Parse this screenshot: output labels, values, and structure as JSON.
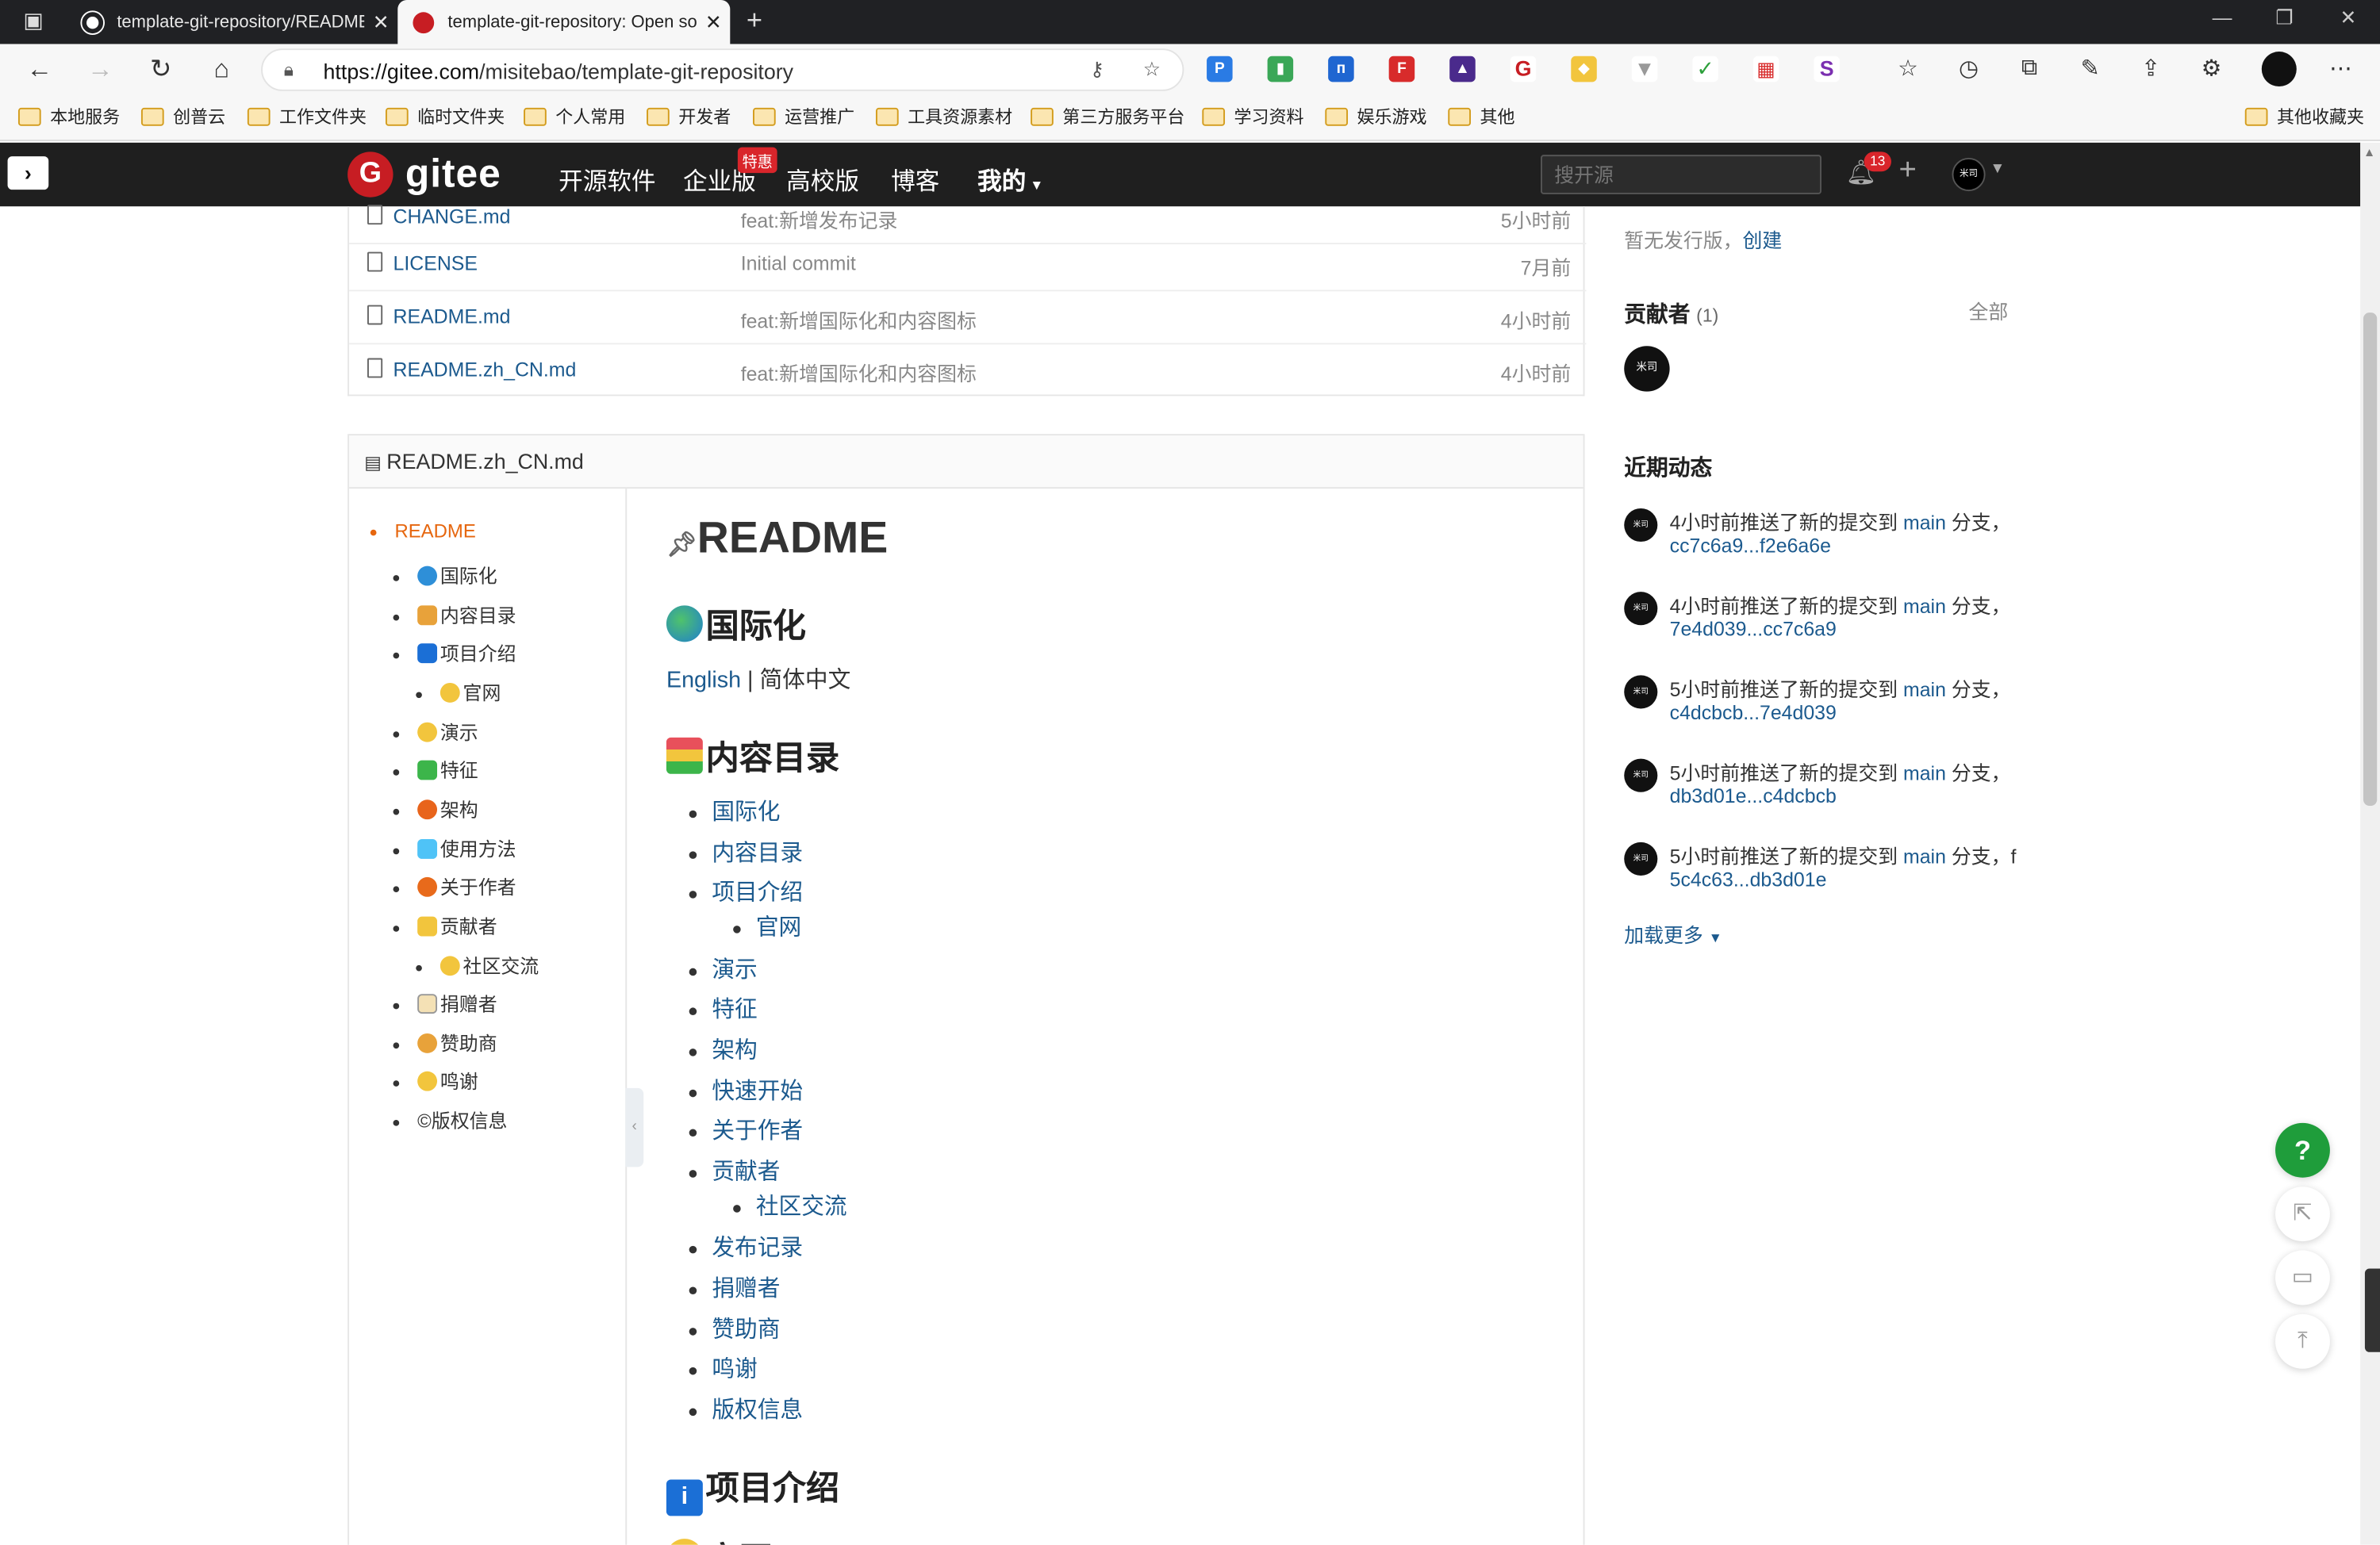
{
  "browser": {
    "tabs": [
      {
        "title": "template-git-repository/README.",
        "close": "✕"
      },
      {
        "title": "template-git-repository: Open so",
        "close": "✕"
      }
    ],
    "new_tab": "+",
    "url_host": "https://gitee.com",
    "url_path": "/misitebao/template-git-repository",
    "bookmarks": [
      "本地服务",
      "创普云",
      "工作文件夹",
      "临时文件夹",
      "个人常用",
      "开发者",
      "运营推广",
      "工具资源素材",
      "第三方服务平台",
      "学习资料",
      "娱乐游戏",
      "其他"
    ],
    "other_bookmarks": "其他收藏夹"
  },
  "gitee": {
    "logo_text": "gitee",
    "nav": [
      "开源软件",
      "企业版",
      "高校版",
      "博客",
      "我的"
    ],
    "badge": "特惠",
    "search_placeholder": "搜开源",
    "notification_count": "13",
    "avatar_text": "米司"
  },
  "files": [
    {
      "name": "CHANGE.md",
      "message": "feat:新增发布记录",
      "time": "5小时前"
    },
    {
      "name": "LICENSE",
      "message": "Initial commit",
      "time": "7月前"
    },
    {
      "name": "README.md",
      "message": "feat:新增国际化和内容图标",
      "time": "4小时前"
    },
    {
      "name": "README.zh_CN.md",
      "message": "feat:新增国际化和内容图标",
      "time": "4小时前"
    }
  ],
  "readme": {
    "filename": "README.zh_CN.md",
    "toc": [
      {
        "label": "README",
        "level": 0,
        "active": true
      },
      {
        "label": "国际化",
        "level": 1
      },
      {
        "label": "内容目录",
        "level": 1
      },
      {
        "label": "项目介绍",
        "level": 1
      },
      {
        "label": "官网",
        "level": 2
      },
      {
        "label": "演示",
        "level": 1
      },
      {
        "label": "特征",
        "level": 1
      },
      {
        "label": "架构",
        "level": 1
      },
      {
        "label": "使用方法",
        "level": 1
      },
      {
        "label": "关于作者",
        "level": 1
      },
      {
        "label": "贡献者",
        "level": 1
      },
      {
        "label": "社区交流",
        "level": 2
      },
      {
        "label": "捐赠者",
        "level": 1
      },
      {
        "label": "赞助商",
        "level": 1
      },
      {
        "label": "鸣谢",
        "level": 1
      },
      {
        "label": "©版权信息",
        "level": 1
      }
    ],
    "h1": "README",
    "h2_i18n": "国际化",
    "lang_english": "English",
    "lang_sep": " | ",
    "lang_chinese": "简体中文",
    "h2_contents": "内容目录",
    "contents": [
      {
        "label": "国际化",
        "level": 1
      },
      {
        "label": "内容目录",
        "level": 1
      },
      {
        "label": "项目介绍",
        "level": 1
      },
      {
        "label": "官网",
        "level": 2
      },
      {
        "label": "演示",
        "level": 1
      },
      {
        "label": "特征",
        "level": 1
      },
      {
        "label": "架构",
        "level": 1
      },
      {
        "label": "快速开始",
        "level": 1
      },
      {
        "label": "关于作者",
        "level": 1
      },
      {
        "label": "贡献者",
        "level": 1
      },
      {
        "label": "社区交流",
        "level": 2
      },
      {
        "label": "发布记录",
        "level": 1
      },
      {
        "label": "捐赠者",
        "level": 1
      },
      {
        "label": "赞助商",
        "level": 1
      },
      {
        "label": "鸣谢",
        "level": 1
      },
      {
        "label": "版权信息",
        "level": 1
      }
    ],
    "h2_intro": "项目介绍",
    "h2_next": "官网",
    "info_icon": "i"
  },
  "sidebar": {
    "release_text": "暂无发行版，",
    "release_link": "创建",
    "contributors_title": "贡献者",
    "contributors_count": "(1)",
    "contributors_all": "全部",
    "activity_title": "近期动态",
    "activities": [
      {
        "text": "4小时前推送了新的提交到",
        "branch": "main",
        "suffix": "分支，",
        "commits": "cc7c6a9...f2e6a6e"
      },
      {
        "text": "4小时前推送了新的提交到",
        "branch": "main",
        "suffix": "分支，",
        "commits": "7e4d039...cc7c6a9"
      },
      {
        "text": "5小时前推送了新的提交到",
        "branch": "main",
        "suffix": "分支，",
        "commits": "c4dcbcb...7e4d039"
      },
      {
        "text": "5小时前推送了新的提交到",
        "branch": "main",
        "suffix": "分支，",
        "commits": "db3d01e...c4dcbcb"
      },
      {
        "text": "5小时前推送了新的提交到",
        "branch": "main",
        "suffix": "分支，f",
        "commits": "5c4c63...db3d01e"
      }
    ],
    "load_more": "加载更多"
  },
  "fabs": {
    "help": "?"
  },
  "colors": {
    "gitee_red": "#c71d23",
    "link": "#1c5a8e",
    "toc_active": "#e6660e",
    "help_green": "#1f9d3b",
    "header_bg": "#1f1f1f"
  }
}
